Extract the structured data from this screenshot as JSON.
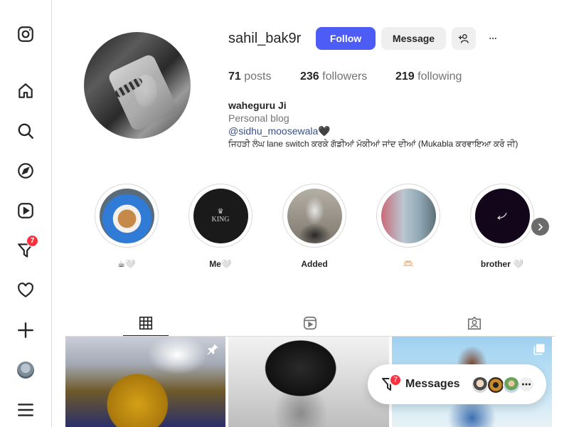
{
  "sidebar": {
    "notifications_badge": "7"
  },
  "profile": {
    "username": "sahil_bak9r",
    "follow_label": "Follow",
    "message_label": "Message",
    "stats": {
      "posts_count": "71",
      "posts_label": "posts",
      "followers_count": "236",
      "followers_label": "followers",
      "following_count": "219",
      "following_label": "following"
    },
    "bio": {
      "name": "waheguru Ji",
      "category": "Personal blog",
      "mention": "@sidhu_moosewala",
      "mention_suffix": "🖤",
      "line": "ਜਿਹੜੀ ਲੰਘ lane switch ਕਰਕੇ ਗੱਡੀਆਂ ਮੱਕੀਆਂ ਜਾਂਦ ਦੀਆਂ (Mukabla ਕਰਵਾਇਆ ਕਰੋ ਜੀ)"
    }
  },
  "highlights": [
    {
      "label": "☕🤍"
    },
    {
      "label": "Me🤍"
    },
    {
      "label": "Added"
    },
    {
      "label": "🫶🏻"
    },
    {
      "label": "brother 🤍"
    }
  ],
  "tabs": [
    "posts-grid",
    "reels",
    "tagged"
  ],
  "messages": {
    "label": "Messages",
    "badge": "7"
  },
  "colors": {
    "accent": "#4c5cf5",
    "notification": "#ff3040",
    "mention": "#385185"
  }
}
